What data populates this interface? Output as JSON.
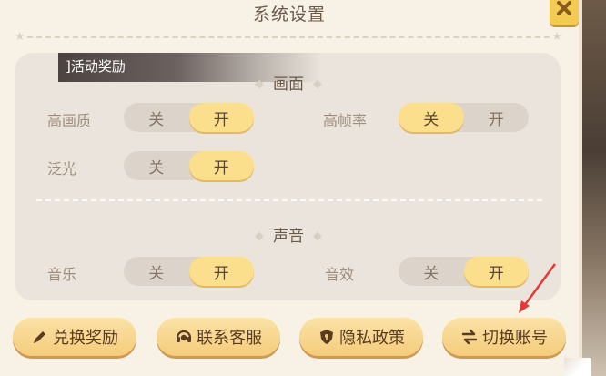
{
  "dialog": {
    "title": "系统设置",
    "close_icon": "close-x-icon",
    "activity_banner": "]活动奖励"
  },
  "display": {
    "section_title": "画面",
    "settings": [
      {
        "label": "高画质",
        "off": "关",
        "on": "开",
        "selected": "开"
      },
      {
        "label": "高帧率",
        "off": "关",
        "on": "开",
        "selected": "关"
      },
      {
        "label": "泛光",
        "off": "关",
        "on": "开",
        "selected": "开"
      }
    ]
  },
  "sound": {
    "section_title": "声音",
    "settings": [
      {
        "label": "音乐",
        "off": "关",
        "on": "开",
        "selected": "开"
      },
      {
        "label": "音效",
        "off": "关",
        "on": "开",
        "selected": "开"
      }
    ]
  },
  "actions": [
    {
      "label": "兑换奖励",
      "icon": "pencil-icon"
    },
    {
      "label": "联系客服",
      "icon": "headset-icon"
    },
    {
      "label": "隐私政策",
      "icon": "shield-icon"
    },
    {
      "label": "切换账号",
      "icon": "swap-arrows-icon"
    }
  ],
  "colors": {
    "accent_active": "#fbdf8c",
    "button": "#f4cc7c",
    "annotation_arrow": "#e53935"
  }
}
